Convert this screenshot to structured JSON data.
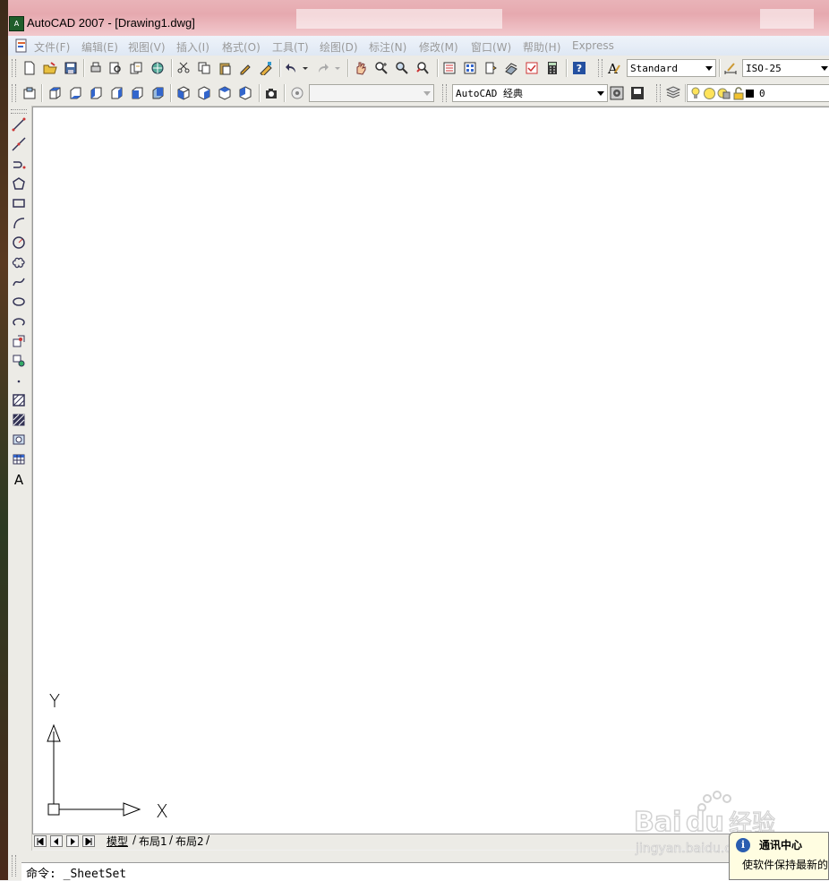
{
  "window": {
    "title": "AutoCAD 2007 - [Drawing1.dwg]",
    "app_icon_text": "A"
  },
  "menu": {
    "items": [
      "文件(F)",
      "编辑(E)",
      "视图(V)",
      "插入(I)",
      "格式(O)",
      "工具(T)",
      "绘图(D)",
      "标注(N)",
      "修改(M)",
      "窗口(W)",
      "帮助(H)",
      "Express"
    ]
  },
  "toolbar": {
    "text_style": "Standard",
    "dim_style": "ISO-25",
    "workspace": "AutoCAD 经典",
    "view_combo": "",
    "layer": "0"
  },
  "tabs": {
    "model": "模型",
    "layout1": "布局1",
    "layout2": "布局2"
  },
  "ucs": {
    "x_label": "X",
    "y_label": "Y"
  },
  "command": {
    "text": "命令: _SheetSet"
  },
  "balloon": {
    "title": "通讯中心",
    "body": "使软件保持最新的"
  },
  "colors": {
    "titlebar": "#e6a9af",
    "toolbar_bg": "#ecebe6",
    "canvas_bg": "#ffffff",
    "balloon_bg": "#fffde1"
  }
}
